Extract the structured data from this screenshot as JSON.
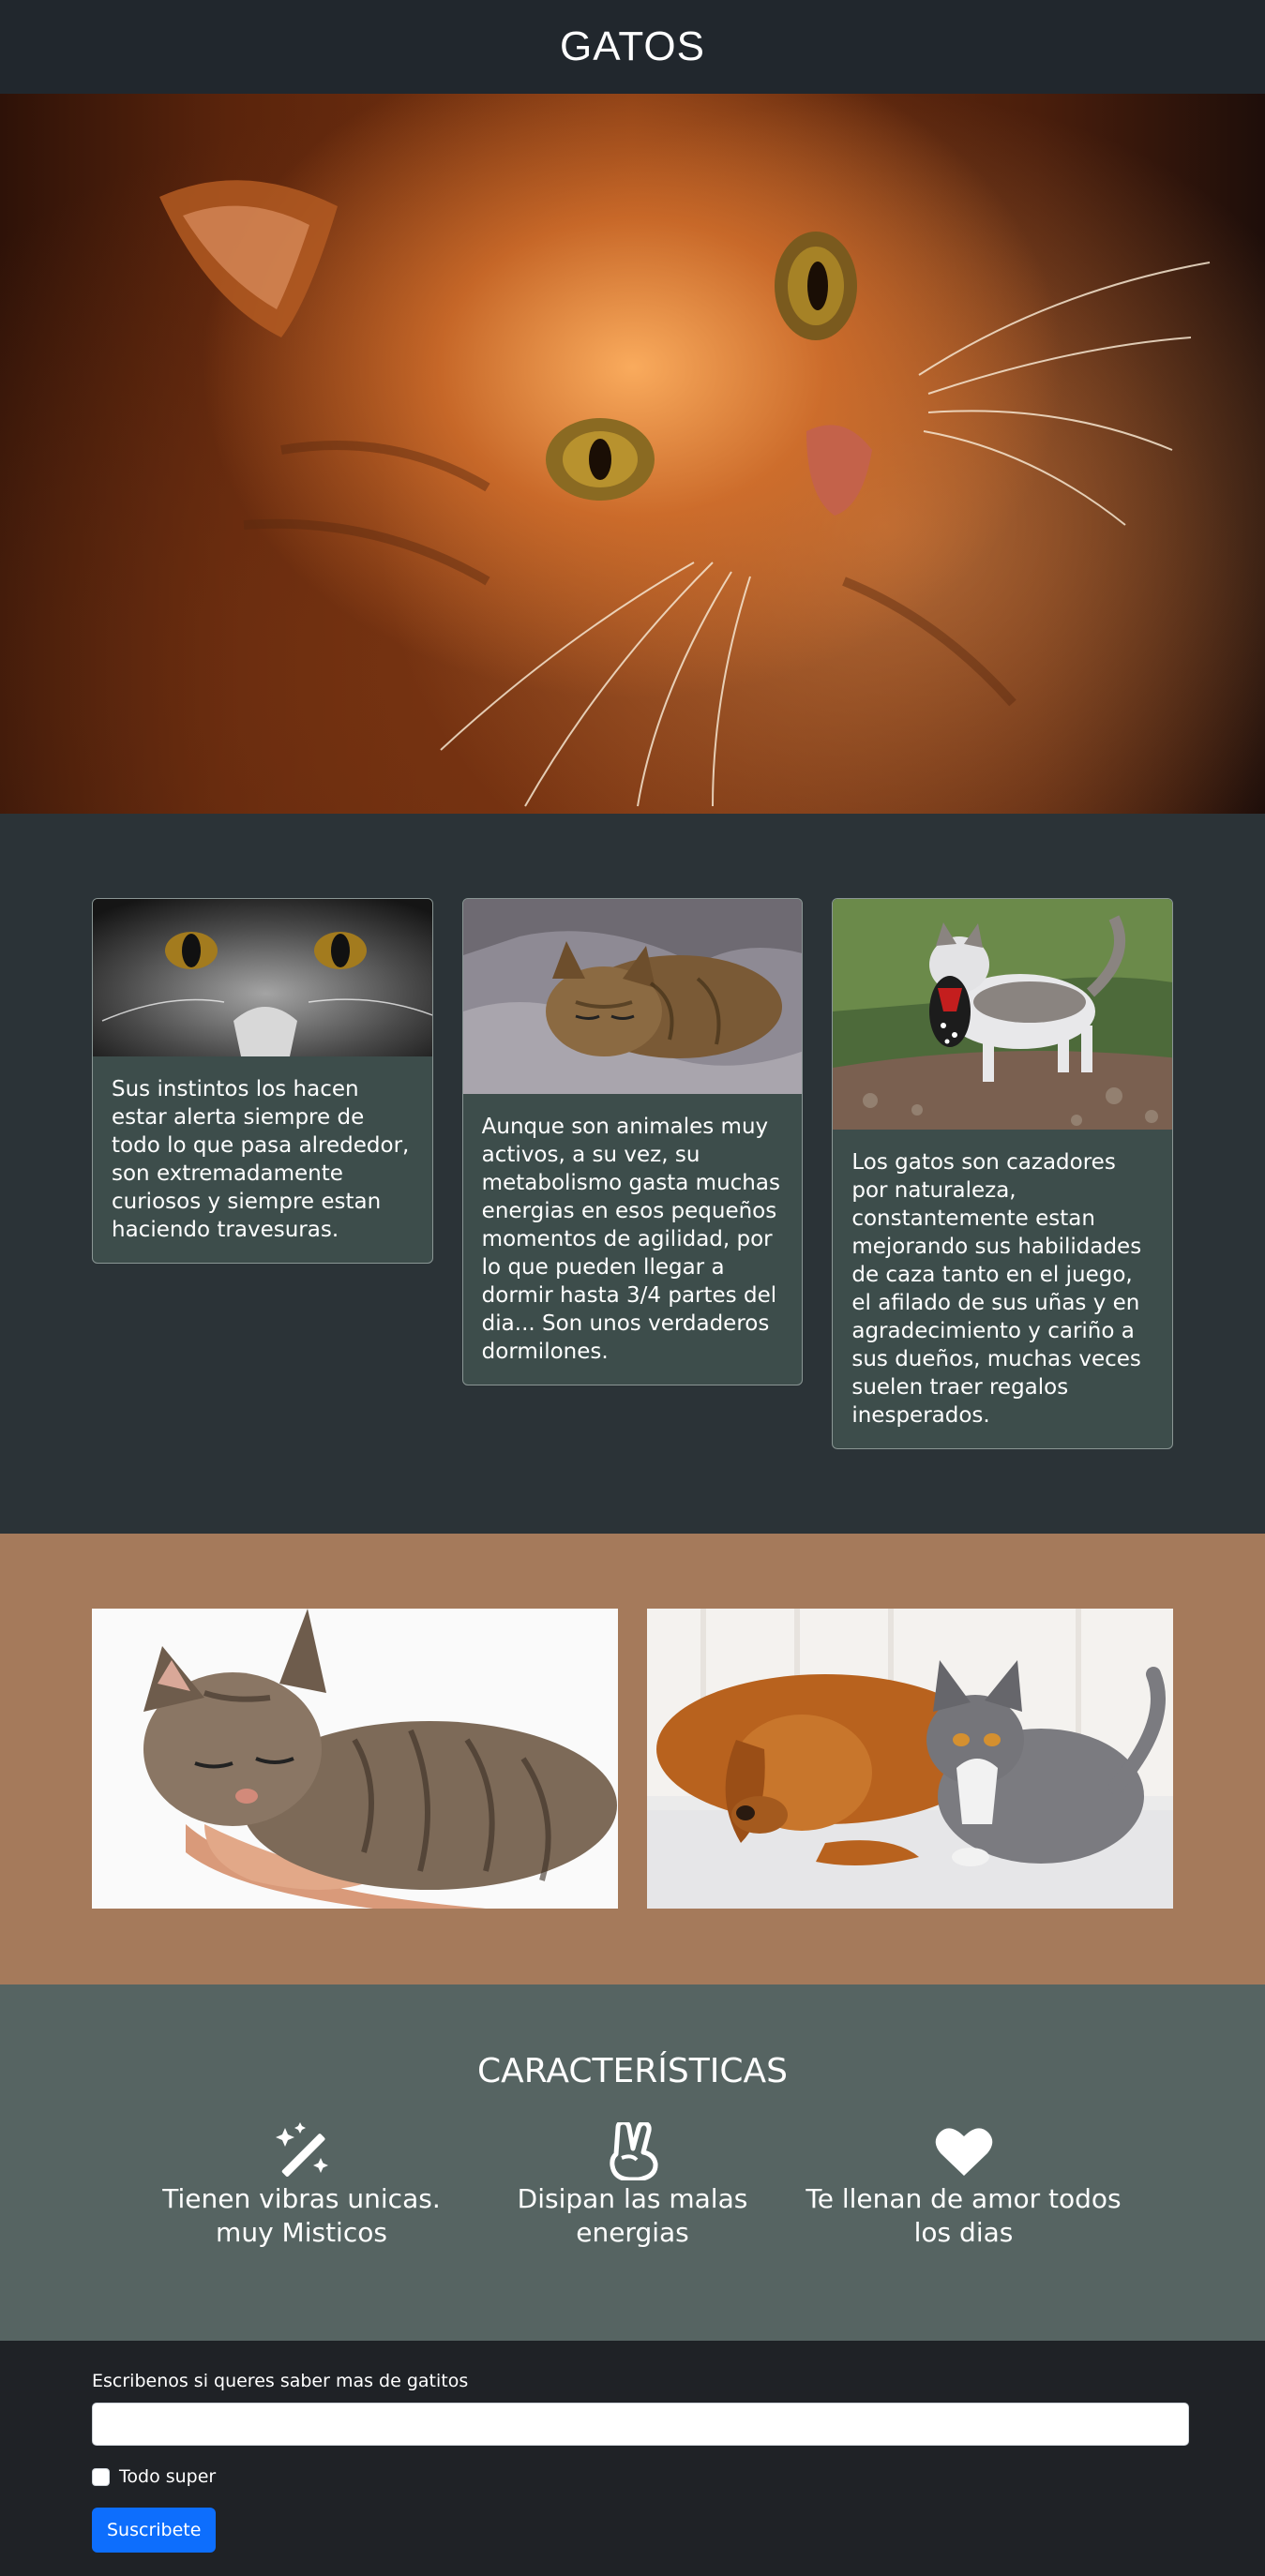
{
  "header": {
    "title": "GATOS"
  },
  "cards": [
    {
      "text": "Sus instintos los hacen estar alerta siempre de todo lo que pasa alrededor, son extremadamente curiosos y siempre estan haciendo travesuras."
    },
    {
      "text": "Aunque son animales muy activos, a su vez, su metabolismo gasta muchas energias en esos pequeños momentos de agilidad, por lo que pueden llegar a dormir hasta 3/4 partes del dia... Son unos verdaderos dormilones."
    },
    {
      "text": "Los gatos son cazadores por naturaleza, constantemente estan mejorando sus habilidades de caza tanto en el juego, el afilado de sus uñas y en agradecimiento y cariño a sus dueños, muchas veces suelen traer regalos inesperados."
    }
  ],
  "features": {
    "title": "CARACTERÍSTICAS",
    "items": [
      {
        "icon": "magic-wand-icon",
        "label": "Tienen vibras unicas. muy Misticos"
      },
      {
        "icon": "peace-hand-icon",
        "label": "Disipan las malas energias"
      },
      {
        "icon": "heart-icon",
        "label": "Te llenan de amor todos los dias"
      }
    ]
  },
  "subscribe": {
    "label": "Escribenos si queres saber mas de gatitos",
    "input_value": "",
    "checkbox_label": "Todo super",
    "checkbox_checked": false,
    "button_label": "Suscribete",
    "button_color": "#0d6efd"
  },
  "colors": {
    "header_bg": "#21272d",
    "cards_section_bg": "#2b3337",
    "card_bg": "#3d4d4b",
    "photos_section_bg": "#a57a5b",
    "features_bg": "#566462",
    "footer_bg": "#1f2226"
  }
}
